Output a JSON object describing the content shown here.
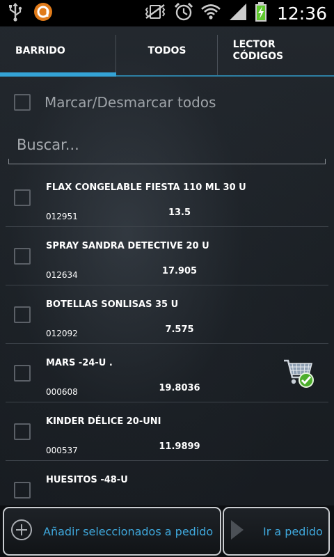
{
  "status_bar": {
    "clock": "12:36",
    "icons": [
      "usb-icon",
      "avast-icon",
      "vibrate-mute-icon",
      "alarm-icon",
      "wifi-icon",
      "signal-icon",
      "battery-charging-icon"
    ]
  },
  "tabs": [
    {
      "label": "BARRIDO",
      "active": true
    },
    {
      "label": "TODOS",
      "active": false
    },
    {
      "label": "LECTOR CÓDIGOS",
      "line1": "LECTOR",
      "line2": "CÓDIGOS",
      "active": false
    }
  ],
  "mark_all": {
    "label": "Marcar/Desmarcar todos",
    "checked": false
  },
  "search": {
    "placeholder": "Buscar...",
    "value": ""
  },
  "items": [
    {
      "name": "FLAX CONGELABLE FIESTA 110 ML 30 U",
      "code": "012951",
      "price": "13.5",
      "checked": false,
      "in_order": false
    },
    {
      "name": "SPRAY SANDRA DETECTIVE 20 U",
      "code": "012634",
      "price": "17.905",
      "checked": false,
      "in_order": false
    },
    {
      "name": "BOTELLAS SONLISAS 35 U",
      "code": "012092",
      "price": "7.575",
      "checked": false,
      "in_order": false
    },
    {
      "name": "MARS -24-U .",
      "code": "000608",
      "price": "19.8036",
      "checked": false,
      "in_order": true
    },
    {
      "name": "KINDER DÉLICE 20-UNI",
      "code": "000537",
      "price": "11.9899",
      "checked": false,
      "in_order": false
    },
    {
      "name": "HUESITOS -48-U",
      "code": "",
      "price": "",
      "checked": false,
      "in_order": false
    }
  ],
  "buttons": {
    "add_label": "Añadir seleccionados a pedido",
    "go_label": "Ir a pedido"
  },
  "colors": {
    "accent": "#34a3d6",
    "button_text": "#3fa8dc",
    "background": "#1b2025"
  }
}
